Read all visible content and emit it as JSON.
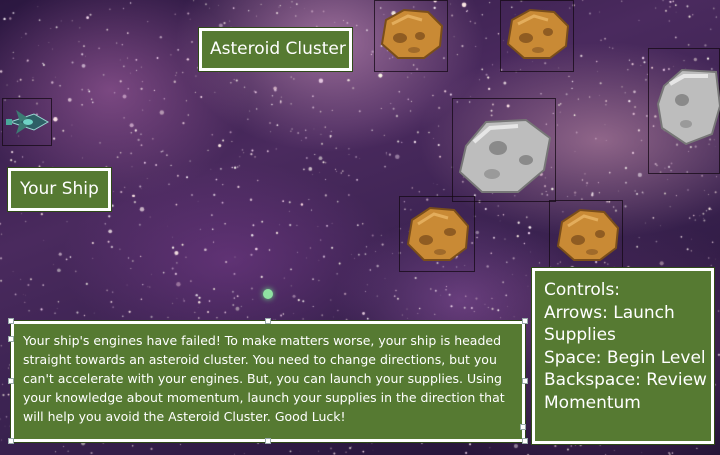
{
  "labels": {
    "asteroid_cluster": "Asteroid Cluster",
    "your_ship": "Your Ship"
  },
  "controls": {
    "title": "Controls:",
    "lines": [
      "Arrows: Launch\nSupplies",
      "Space: Begin Level",
      "Backspace: Review\nMomentum"
    ]
  },
  "message": "Your ship's engines have failed! To make matters worse, your ship is headed straight towards an asteroid cluster. You need to change directions, but you can't accelerate with your engines. But, you can launch your supplies. Using your knowledge about momentum, launch your supplies in the direction that will help you avoid the Asteroid Cluster. Good Luck!",
  "colors": {
    "panel_green": "#567a32",
    "panel_border": "#ffffff",
    "asteroid_brown": "#c98a35",
    "asteroid_gray": "#bdbdbd",
    "space_purple": "#3a2250"
  },
  "objects": {
    "ship": "spaceship-icon",
    "supply": "supply-pod-icon",
    "asteroids": [
      "asteroid-brown",
      "asteroid-brown",
      "asteroid-gray",
      "asteroid-gray",
      "asteroid-brown",
      "asteroid-brown"
    ]
  }
}
